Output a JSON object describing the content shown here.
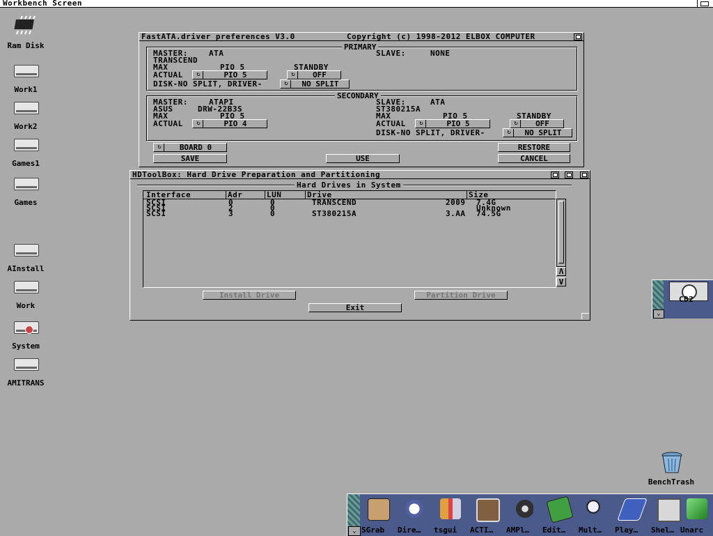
{
  "screen": {
    "title": "Workbench Screen"
  },
  "desktop_icons": [
    {
      "label": "Ram Disk",
      "icon": "chip-icon"
    },
    {
      "label": "Work1",
      "icon": "harddisk-icon"
    },
    {
      "label": "Work2",
      "icon": "harddisk-icon"
    },
    {
      "label": "Games1",
      "icon": "harddisk-icon"
    },
    {
      "label": "Games",
      "icon": "harddisk-icon"
    },
    {
      "label": "AInstall",
      "icon": "harddisk-icon"
    },
    {
      "label": "Work",
      "icon": "harddisk-icon"
    },
    {
      "label": "System",
      "icon": "harddisk-icon"
    },
    {
      "label": "AMITRANS",
      "icon": "harddisk-icon"
    },
    {
      "label": "BenchTrash",
      "icon": "trash-icon"
    },
    {
      "label": "CD2",
      "icon": "cdrom-icon"
    }
  ],
  "fastata": {
    "title": "FastATA.driver preferences V3.0",
    "copyright": "Copyright (c) 1998-2012 ELBOX COMPUTER",
    "primary": {
      "group_title": "PRIMARY",
      "master_label": "MASTER:",
      "master_value": "ATA",
      "slave_label": "SLAVE:",
      "slave_value": "NONE",
      "model": "TRANSCEND",
      "max_label": "MAX",
      "max_value": "PIO 5",
      "standby_label": "STANDBY",
      "actual_label": "ACTUAL",
      "actual_value": "PIO 5",
      "standby_value": "OFF",
      "disk_label": "DISK-NO SPLIT, DRIVER-",
      "split_value": "NO SPLIT"
    },
    "secondary": {
      "group_title": "SECONDARY",
      "master_label": "MASTER:",
      "master_value": "ATAPI",
      "master_model_a": "ASUS",
      "master_model_b": "DRW-22B3S",
      "max_label": "MAX",
      "master_max": "PIO 5",
      "actual_label": "ACTUAL",
      "master_actual": "PIO 4",
      "slave_label": "SLAVE:",
      "slave_value": "ATA",
      "slave_model": "ST380215A",
      "slave_max": "PIO 5",
      "standby_label": "STANDBY",
      "slave_actual": "PIO 5",
      "standby_value": "OFF",
      "disk_label": "DISK-NO SPLIT, DRIVER-",
      "split_value": "NO SPLIT"
    },
    "buttons": {
      "board": "BOARD 0",
      "restore": "RESTORE",
      "save": "SAVE",
      "use": "USE",
      "cancel": "CANCEL"
    }
  },
  "hdtoolbox": {
    "title": "HDToolBox: Hard Drive Preparation and Partitioning",
    "group_title": "Hard Drives in System",
    "columns": [
      "Interface",
      "Adr",
      "LUN",
      "Drive",
      "Size"
    ],
    "rows": [
      {
        "iface": "SCSI",
        "adr": "0",
        "lun": "0",
        "drive": "TRANSCEND",
        "rev": "2009",
        "size": "7.4G"
      },
      {
        "iface": "SCSI",
        "adr": "2",
        "lun": "0",
        "drive": "",
        "rev": "",
        "size": "Unknown"
      },
      {
        "iface": "SCSI",
        "adr": "3",
        "lun": "0",
        "drive": "ST380215A",
        "rev": "3.AA",
        "size": "74.5G"
      }
    ],
    "install_button": "Install Drive",
    "partition_button": "Partition Drive",
    "exit_button": "Exit",
    "scroll_up": "Λ",
    "scroll_down": "V"
  },
  "dock": [
    {
      "label": "SGrab",
      "color": "#c8a070"
    },
    {
      "label": "Dire…",
      "color": "#d0d0d0"
    },
    {
      "label": "tsgui",
      "color": "#e05050"
    },
    {
      "label": "ACTI…",
      "color": "#806040"
    },
    {
      "label": "AMPl…",
      "color": "#303030"
    },
    {
      "label": "Edit…",
      "color": "#40a040"
    },
    {
      "label": "Mult…",
      "color": "#c0c0d0"
    },
    {
      "label": "Play…",
      "color": "#4060c0"
    },
    {
      "label": "Shel…",
      "color": "#d8d8d8"
    },
    {
      "label": "Unarc",
      "color": "#40b040"
    }
  ]
}
